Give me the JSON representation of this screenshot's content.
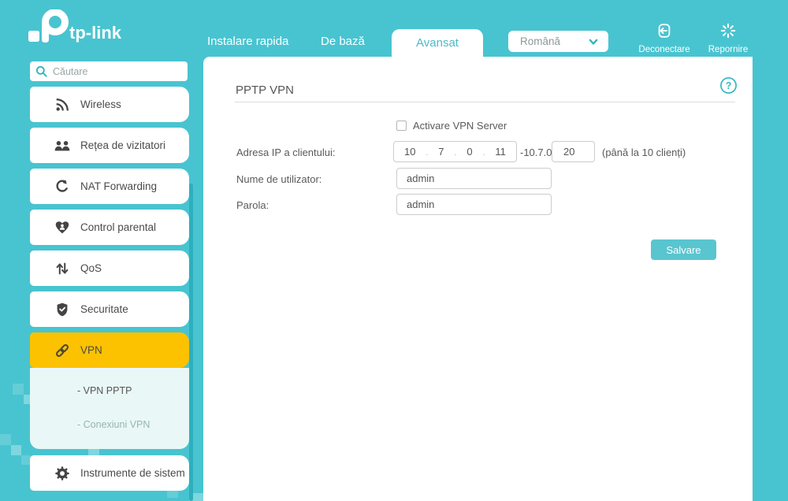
{
  "header": {
    "logo_text": "tp-link",
    "tabs": [
      {
        "label": "Instalare rapida"
      },
      {
        "label": "De bază"
      },
      {
        "label": "Avansat"
      }
    ],
    "language_selected": "Română",
    "logout_label": "Deconectare",
    "reboot_label": "Repornire"
  },
  "sidebar": {
    "search_placeholder": "Căutare",
    "items": [
      {
        "label": "Wireless",
        "icon": "wifi-icon"
      },
      {
        "label": "Rețea de vizitatori",
        "icon": "guest-network-icon"
      },
      {
        "label": "NAT Forwarding",
        "icon": "nat-forwarding-icon"
      },
      {
        "label": "Control parental",
        "icon": "parental-control-icon"
      },
      {
        "label": "QoS",
        "icon": "qos-arrows-icon"
      },
      {
        "label": "Securitate",
        "icon": "security-shield-icon"
      },
      {
        "label": "VPN",
        "icon": "vpn-link-icon"
      },
      {
        "label": "Instrumente de sistem",
        "icon": "system-tools-gear-icon"
      }
    ],
    "vpn_submenu": [
      {
        "label": "- VPN PPTP"
      },
      {
        "label": "- Conexiuni VPN"
      }
    ]
  },
  "main": {
    "title": "PPTP VPN",
    "enable_checkbox_label": "Activare VPN Server",
    "client_ip": {
      "label": "Adresa IP a clientului:",
      "octets": [
        "10",
        "7",
        "0",
        "11"
      ],
      "separator": ".",
      "range_prefix": "-10.7.0.",
      "range_end": "20",
      "hint": "(până la 10 clienți)"
    },
    "username": {
      "label": "Nume de utilizator:",
      "value": "admin"
    },
    "password": {
      "label": "Parola:",
      "value": "admin"
    },
    "save_label": "Salvare"
  },
  "colors": {
    "background_teal": "#48c4d0",
    "accent_teal": "#31b8c4",
    "active_yellow": "#fcc200",
    "button_teal": "#58c5cf",
    "submenu_mint": "#e9f8f6",
    "scrollbar_teal": "#2eafbd",
    "text_dark": "#4a4a4a",
    "text_gray": "#9ab3b1"
  }
}
